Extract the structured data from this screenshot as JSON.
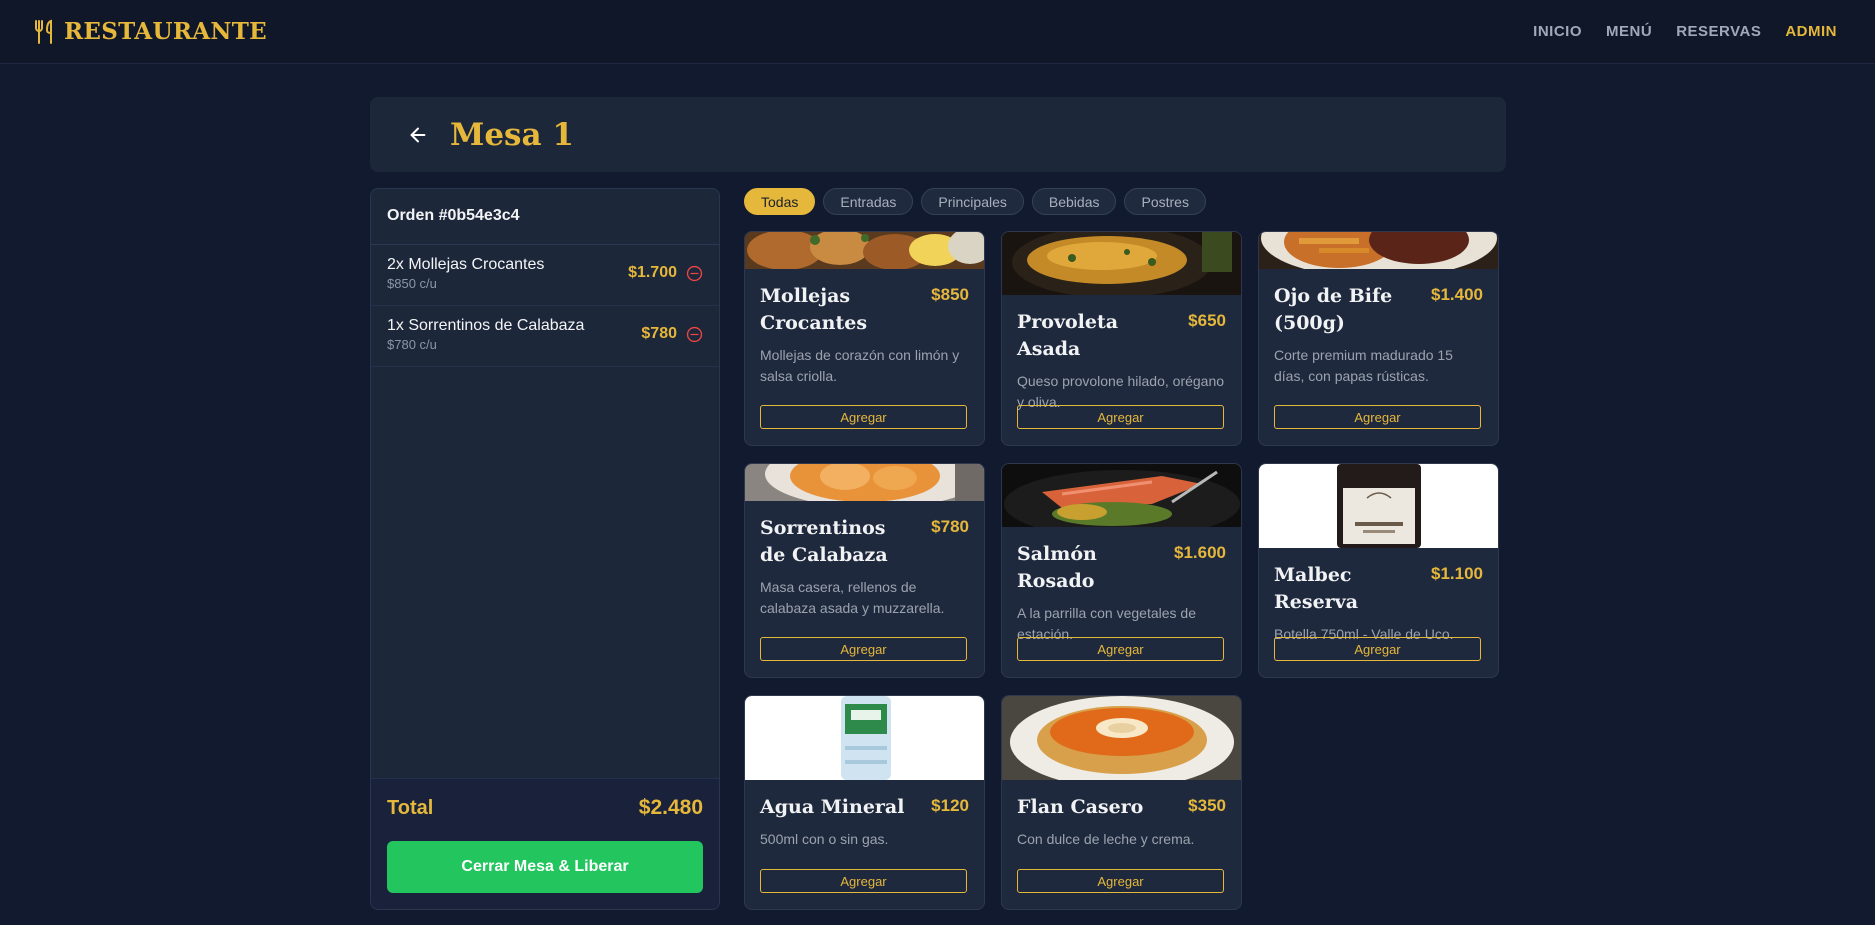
{
  "nav": {
    "brand": "RESTAURANTE",
    "links": [
      "INICIO",
      "MENÚ",
      "RESERVAS",
      "ADMIN"
    ],
    "active": "ADMIN"
  },
  "page": {
    "title": "Mesa 1"
  },
  "order": {
    "header": "Orden #0b54e3c4",
    "items": [
      {
        "name": "2x Mollejas Crocantes",
        "unit": "$850 c/u",
        "total": "$1.700"
      },
      {
        "name": "1x Sorrentinos de Calabaza",
        "unit": "$780 c/u",
        "total": "$780"
      }
    ],
    "total_label": "Total",
    "total_value": "$2.480",
    "close_button": "Cerrar Mesa & Liberar"
  },
  "tabs": [
    "Todas",
    "Entradas",
    "Principales",
    "Bebidas",
    "Postres"
  ],
  "products": [
    {
      "name": "Mollejas Crocantes",
      "price": "$850",
      "desc": "Mollejas de corazón con limón y salsa criolla.",
      "button": "Agregar"
    },
    {
      "name": "Provoleta Asada",
      "price": "$650",
      "desc": "Queso provolone hilado, orégano y oliva.",
      "button": "Agregar"
    },
    {
      "name": "Ojo de Bife (500g)",
      "price": "$1.400",
      "desc": "Corte premium madurado 15 días, con papas rústicas.",
      "button": "Agregar"
    },
    {
      "name": "Sorrentinos de Calabaza",
      "price": "$780",
      "desc": "Masa casera, rellenos de calabaza asada y muzzarella.",
      "button": "Agregar"
    },
    {
      "name": "Salmón Rosado",
      "price": "$1.600",
      "desc": "A la parrilla con vegetales de estación.",
      "button": "Agregar"
    },
    {
      "name": "Malbec Reserva",
      "price": "$1.100",
      "desc": "Botella 750ml - Valle de Uco.",
      "button": "Agregar"
    },
    {
      "name": "Agua Mineral",
      "price": "$120",
      "desc": "500ml con o sin gas.",
      "button": "Agregar"
    },
    {
      "name": "Flan Casero",
      "price": "$350",
      "desc": "Con dulce de leche y crema.",
      "button": "Agregar"
    }
  ],
  "colors": {
    "accent": "#e5b73b",
    "success": "#22c55e",
    "danger": "#ef4444",
    "background": "#111a2e",
    "panel": "#1d273a"
  }
}
